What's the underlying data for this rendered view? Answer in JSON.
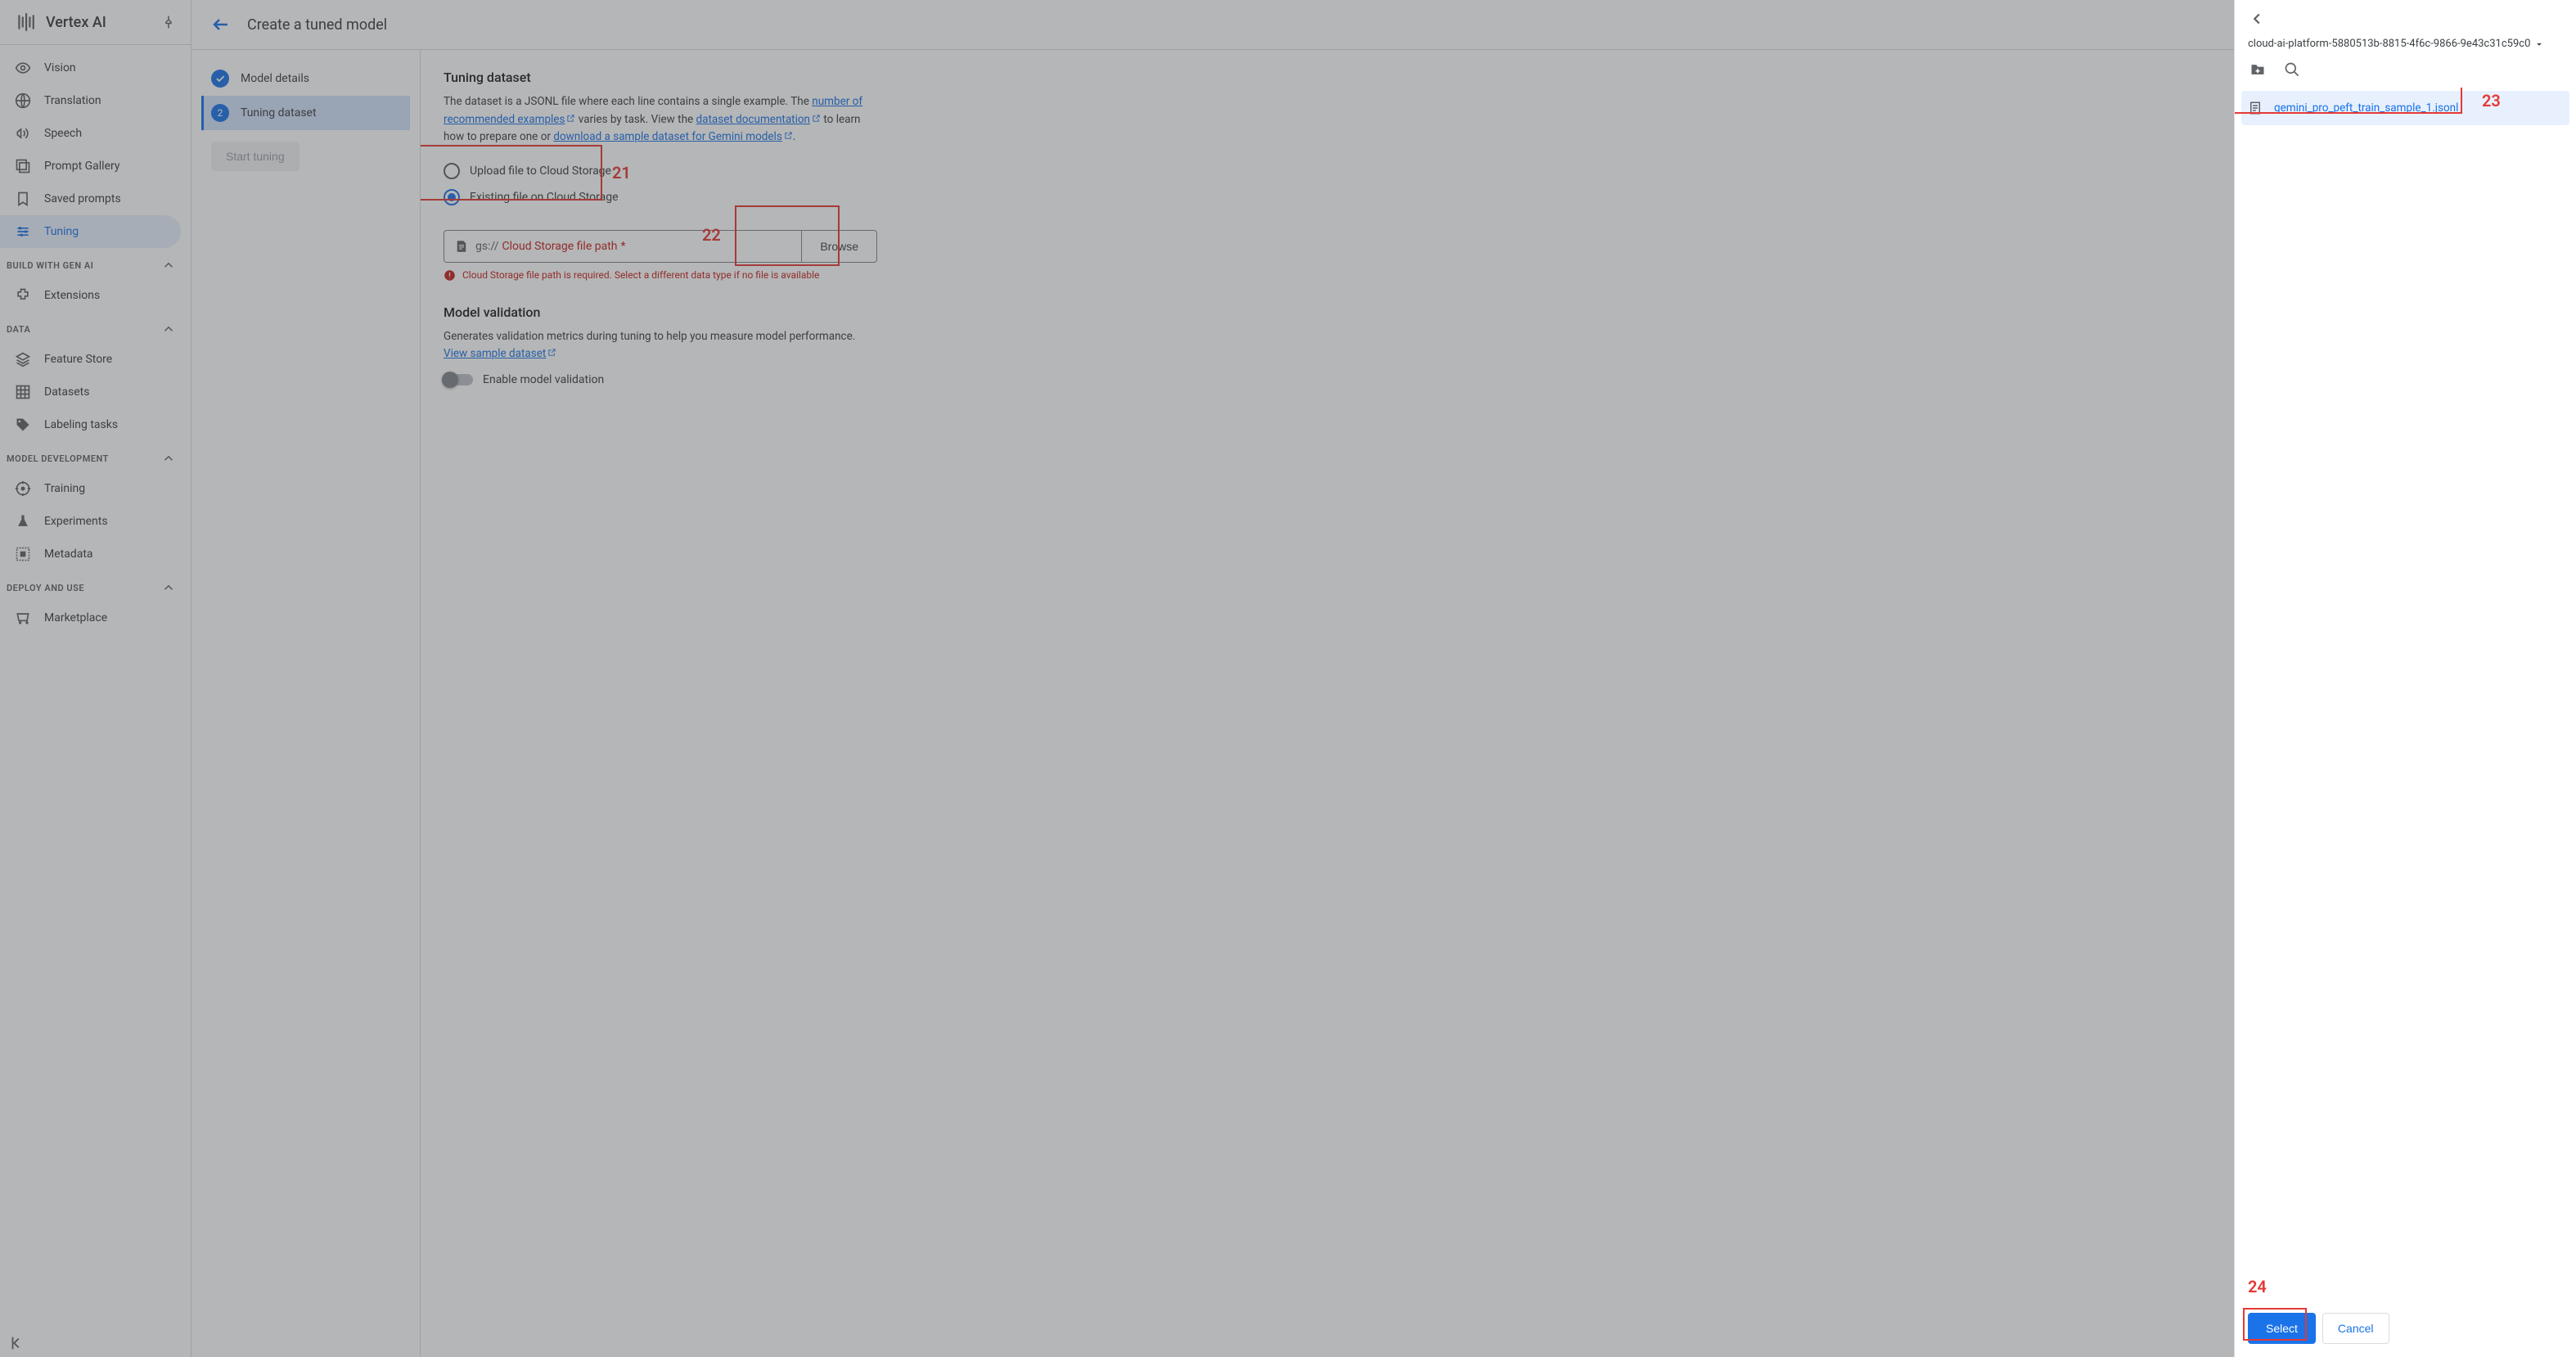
{
  "sidebar": {
    "product_title": "Vertex AI",
    "items_top": [
      {
        "icon": "vision",
        "label": "Vision"
      },
      {
        "icon": "translate",
        "label": "Translation"
      },
      {
        "icon": "speech",
        "label": "Speech"
      },
      {
        "icon": "gallery",
        "label": "Prompt Gallery"
      },
      {
        "icon": "saved",
        "label": "Saved prompts"
      },
      {
        "icon": "tuning",
        "label": "Tuning",
        "active": true
      }
    ],
    "sections": [
      {
        "header": "BUILD WITH GEN AI",
        "items": [
          {
            "icon": "extension",
            "label": "Extensions"
          }
        ]
      },
      {
        "header": "DATA",
        "items": [
          {
            "icon": "feature",
            "label": "Feature Store"
          },
          {
            "icon": "datasets",
            "label": "Datasets"
          },
          {
            "icon": "label",
            "label": "Labeling tasks"
          }
        ]
      },
      {
        "header": "MODEL DEVELOPMENT",
        "items": [
          {
            "icon": "training",
            "label": "Training"
          },
          {
            "icon": "experiments",
            "label": "Experiments"
          },
          {
            "icon": "metadata",
            "label": "Metadata"
          }
        ]
      },
      {
        "header": "DEPLOY AND USE",
        "items": [
          {
            "icon": "marketplace",
            "label": "Marketplace"
          }
        ]
      }
    ]
  },
  "page": {
    "title": "Create a tuned model",
    "steps": [
      {
        "label": "Model details",
        "state": "done"
      },
      {
        "label": "Tuning dataset",
        "state": "current",
        "number": "2"
      }
    ],
    "start_tuning": "Start tuning"
  },
  "tuning": {
    "heading": "Tuning dataset",
    "desc_part1": "The dataset is a JSONL file where each line contains a single example. The ",
    "link_rec": "number of recommended examples",
    "desc_part2": " varies by task. View the ",
    "link_doc": "dataset documentation",
    "desc_part3": " to learn how to prepare one or ",
    "link_sample": "download a sample dataset for Gemini models",
    "desc_part4": ".",
    "radio_upload": "Upload file to Cloud Storage",
    "radio_existing": "Existing file on Cloud Storage",
    "gs_prefix": "gs://",
    "gs_placeholder": "Cloud Storage file path",
    "gs_req": "*",
    "browse": "Browse",
    "error_msg": "Cloud Storage file path is required. Select a different data type if no file is available"
  },
  "validation": {
    "heading": "Model validation",
    "desc": "Generates validation metrics during tuning to help you measure model performance. ",
    "link": "View sample dataset",
    "toggle_label": "Enable model validation"
  },
  "picker": {
    "breadcrumb": "cloud-ai-platform-5880513b-8815-4f6c-9866-9e43c31c59c0",
    "items": [
      {
        "name": "gemini_pro_peft_train_sample_1.jsonl",
        "selected": true
      }
    ],
    "select": "Select",
    "cancel": "Cancel"
  },
  "annotations": {
    "a21": "21",
    "a22": "22",
    "a23": "23",
    "a24": "24"
  }
}
